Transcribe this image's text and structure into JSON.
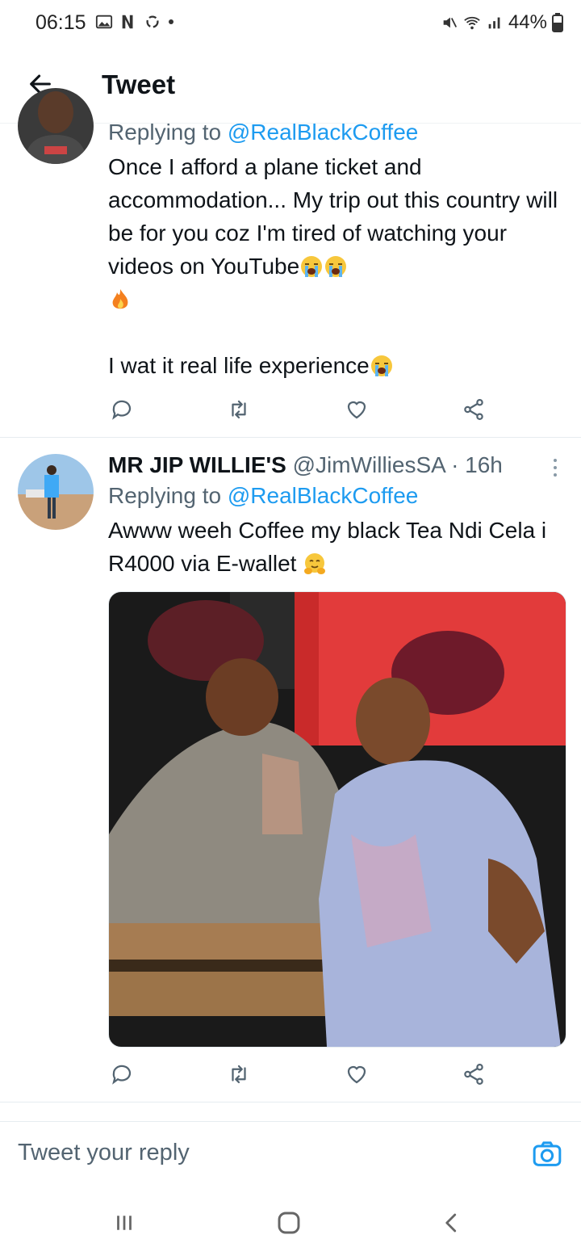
{
  "status_bar": {
    "time": "06:15",
    "battery": "44%"
  },
  "header": {
    "title": "Tweet"
  },
  "tweets": [
    {
      "replying_to_label": "Replying to",
      "replying_to_handle": "@RealBlackCoffee",
      "text": "Once I afford a plane ticket and accommodation... My trip out this country will be for you coz I'm tired of watching your videos on YouTube",
      "text_line2": "I wat it real life experience",
      "emojis": [
        "loudly-crying-face",
        "loudly-crying-face",
        "fire",
        "loudly-crying-face"
      ]
    },
    {
      "author_name": "MR JIP WILLIE'S",
      "author_handle": "@JimWilliesSA",
      "time_ago": "· 16h",
      "replying_to_label": "Replying to",
      "replying_to_handle": "@RealBlackCoffee",
      "text": "Awww weeh Coffee my black Tea Ndi Cela i R4000 via E-wallet",
      "emojis": [
        "hugging-face"
      ]
    }
  ],
  "reply_bar": {
    "placeholder": "Tweet your reply"
  },
  "colors": {
    "accent": "#1d9bf0",
    "text": "#0f1419",
    "secondary": "#536471"
  }
}
